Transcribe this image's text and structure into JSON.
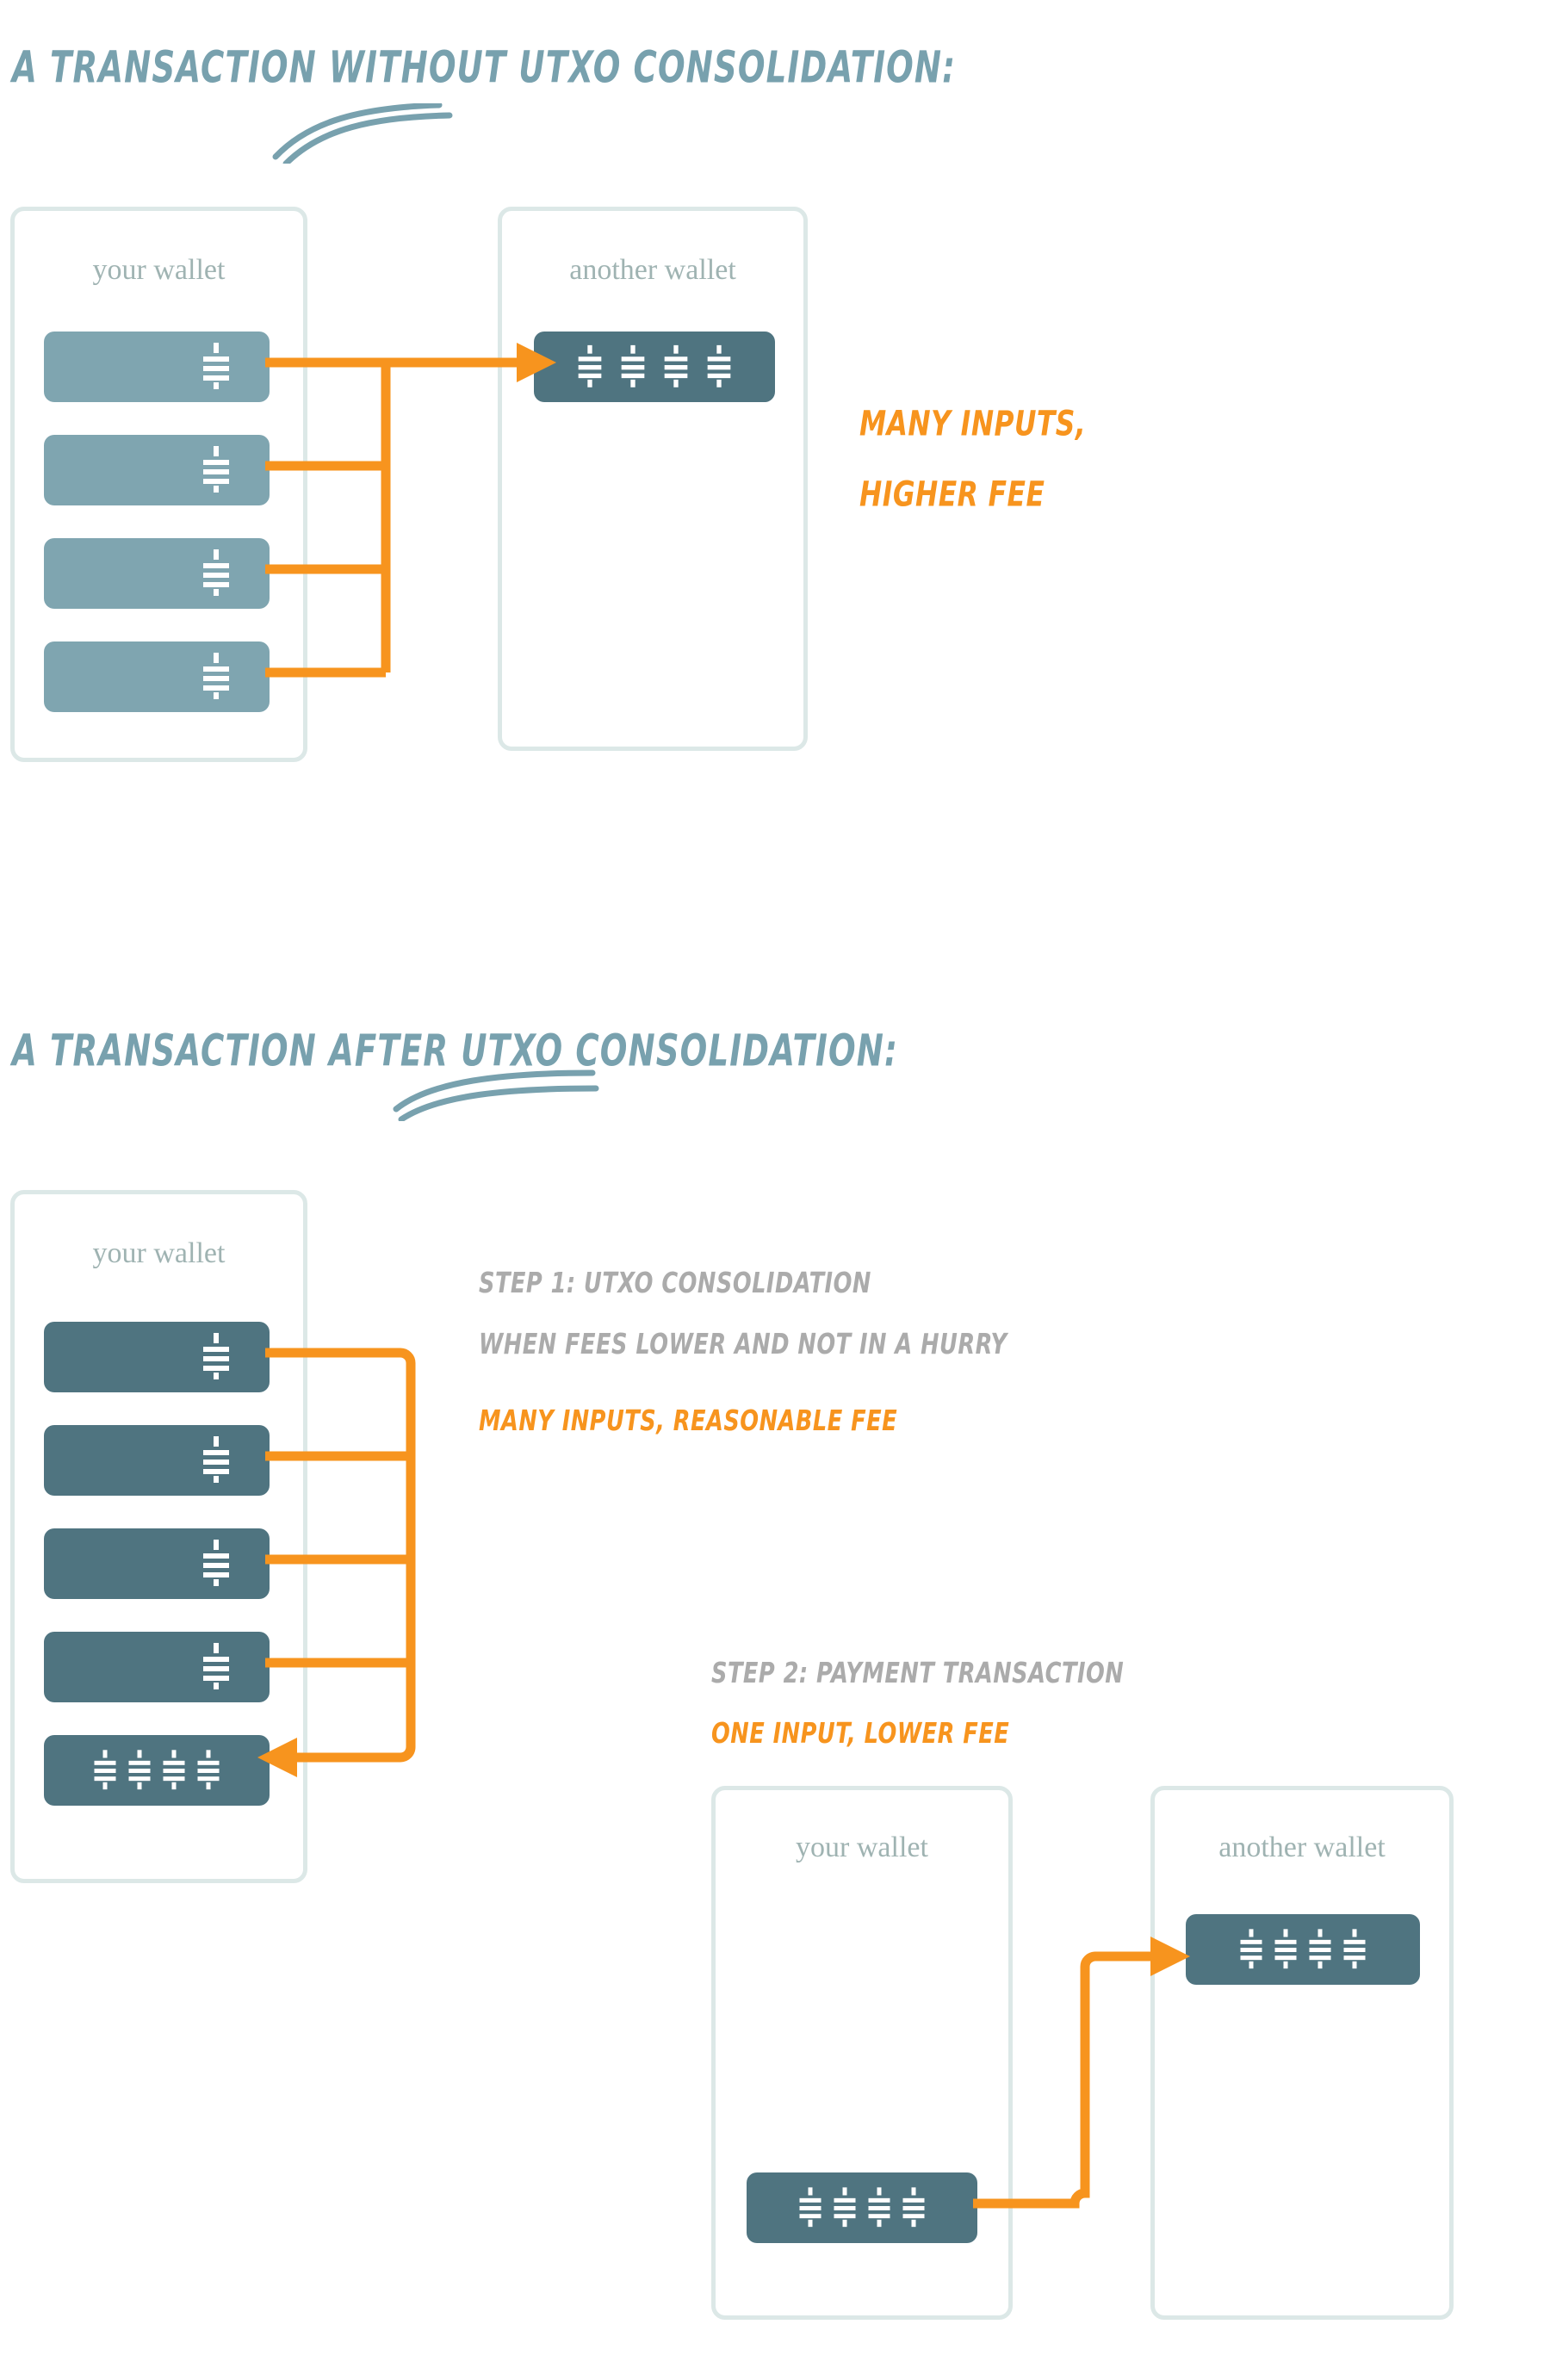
{
  "sections": [
    {
      "id": "without-consolidation",
      "heading": "A TRANSACTION WITHOUT UTXO CONSOLIDATION:",
      "wallets": [
        {
          "label": "your wallet",
          "utxo_count": 4,
          "coins_per_utxo": 1
        },
        {
          "label": "another wallet",
          "utxo_count": 1,
          "coins_per_utxo": 4
        }
      ],
      "notes": [
        {
          "text": "MANY INPUTS,",
          "color": "#F7941E"
        },
        {
          "text": "HIGHER FEE",
          "color": "#F7941E"
        }
      ]
    },
    {
      "id": "after-consolidation",
      "heading": "A TRANSACTION AFTER UTXO CONSOLIDATION:",
      "step1": {
        "title": "STEP 1: UTXO CONSOLIDATION",
        "subtitle": "WHEN FEES LOWER AND NOT IN A HURRY",
        "callout": "MANY INPUTS, REASONABLE FEE",
        "wallet_label": "your wallet",
        "input_utxo_count": 4,
        "output_utxo_coins": 4
      },
      "step2": {
        "title": "STEP 2: PAYMENT TRANSACTION",
        "callout": "ONE INPUT, LOWER FEE",
        "from_wallet_label": "your wallet",
        "to_wallet_label": "another wallet",
        "input_utxo_coins": 4,
        "output_utxo_coins": 4
      }
    }
  ],
  "colors": {
    "heading": "#78A1AE",
    "wallet_border": "#DCE8E7",
    "wallet_label": "#9FB3B2",
    "utxo_light": "#7FA5B0",
    "utxo_dark": "#4F7480",
    "arrow_orange": "#F7941E",
    "note_gray": "#ABABAB",
    "background": "#FFFFFF"
  },
  "icons": {
    "utxo_coin": "coin-stack-icon",
    "arrow": "arrow-icon"
  }
}
